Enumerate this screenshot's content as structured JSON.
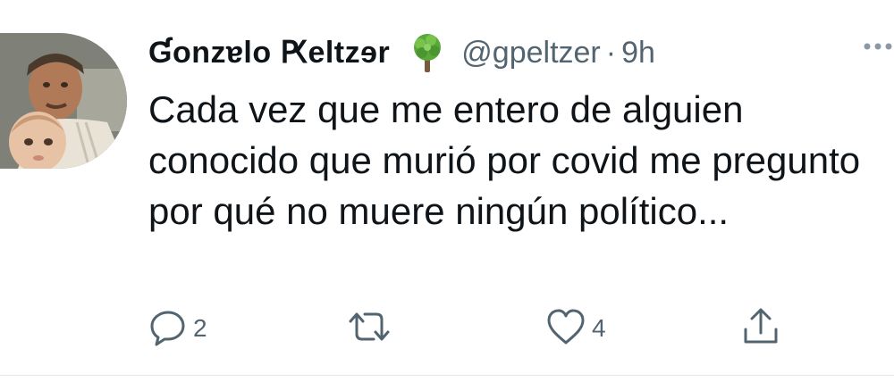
{
  "tweet": {
    "author_name": "Ɠonzɐlo Ԗeltzɘr",
    "handle": "@gpeltzer",
    "separator": "·",
    "time": "9h",
    "author_emoji": "tree-icon",
    "text": "Cada vez que me entero de alguien conocido que murió por covid me pregunto por qué no muere ningún político...",
    "reply_count": "2",
    "retweet_count": "",
    "like_count": "4"
  },
  "colors": {
    "text": "#0f1419",
    "secondary": "#536471",
    "icon": "#536471"
  }
}
